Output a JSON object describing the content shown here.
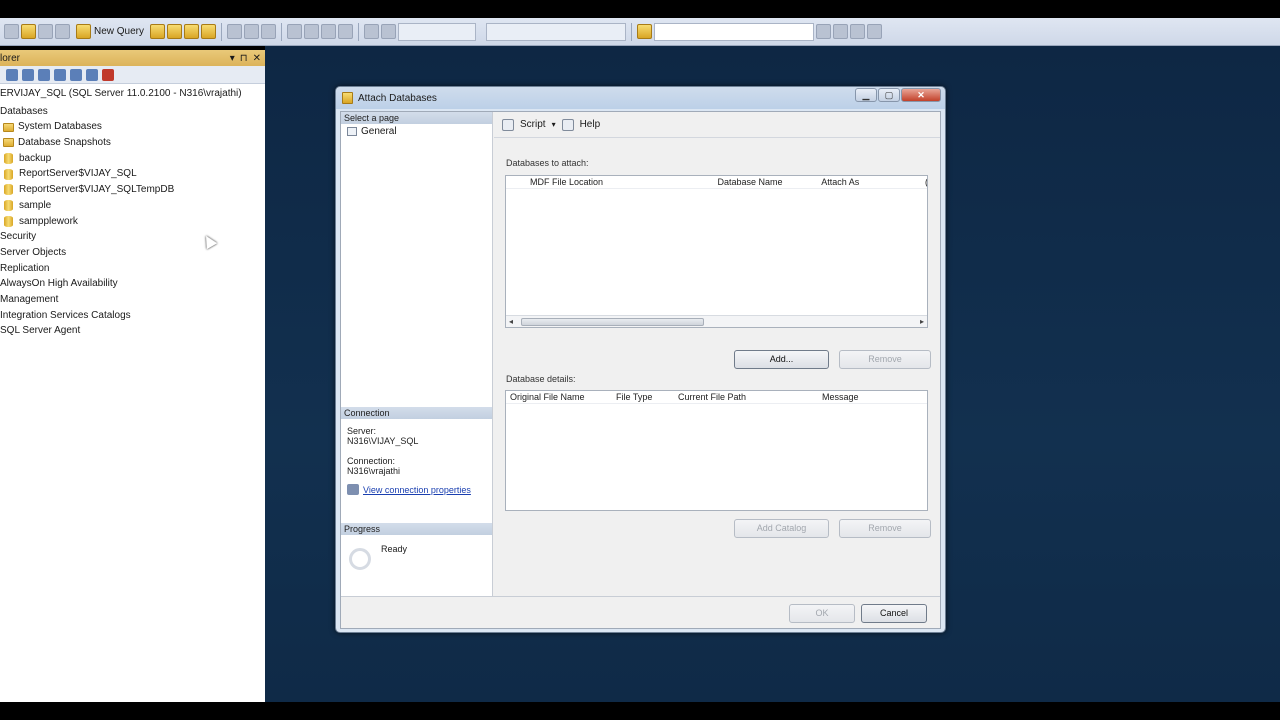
{
  "toolbar": {
    "new_query_label": "New Query"
  },
  "object_explorer": {
    "title": "lorer",
    "server_node": "ERVIJAY_SQL (SQL Server 11.0.2100 - N316\\vrajathi)",
    "items": [
      {
        "label": "Databases",
        "kind": "none",
        "level": "l0"
      },
      {
        "label": "System Databases",
        "kind": "folder",
        "level": "l1"
      },
      {
        "label": "Database Snapshots",
        "kind": "folder",
        "level": "l1"
      },
      {
        "label": "backup",
        "kind": "db",
        "level": "l2"
      },
      {
        "label": "ReportServer$VIJAY_SQL",
        "kind": "db",
        "level": "l2"
      },
      {
        "label": "ReportServer$VIJAY_SQLTempDB",
        "kind": "db",
        "level": "l2"
      },
      {
        "label": "sample",
        "kind": "db",
        "level": "l2"
      },
      {
        "label": "sampplework",
        "kind": "db",
        "level": "l2"
      },
      {
        "label": "Security",
        "kind": "none",
        "level": "l0"
      },
      {
        "label": "Server Objects",
        "kind": "none",
        "level": "l0"
      },
      {
        "label": "Replication",
        "kind": "none",
        "level": "l0"
      },
      {
        "label": "AlwaysOn High Availability",
        "kind": "none",
        "level": "l0"
      },
      {
        "label": "Management",
        "kind": "none",
        "level": "l0"
      },
      {
        "label": "Integration Services Catalogs",
        "kind": "none",
        "level": "l0"
      },
      {
        "label": "SQL Server Agent",
        "kind": "none",
        "level": "l0"
      }
    ]
  },
  "dialog": {
    "title": "Attach Databases",
    "select_page_header": "Select a page",
    "pages": [
      "General"
    ],
    "script_label": "Script",
    "help_label": "Help",
    "attach_label": "Databases to attach:",
    "attach_columns": [
      "MDF File Location",
      "Database Name",
      "Attach As",
      "("
    ],
    "add_button": "Add...",
    "remove_button": "Remove",
    "details_label": "Database details:",
    "details_columns": [
      "Original File Name",
      "File Type",
      "Current File Path",
      "Message"
    ],
    "add_catalog_button": "Add Catalog",
    "remove_button_2": "Remove",
    "connection_header": "Connection",
    "server_label": "Server:",
    "server_value": "N316\\VIJAY_SQL",
    "connection_label": "Connection:",
    "connection_value": "N316\\vrajathi",
    "view_connection_link": "View connection properties",
    "progress_header": "Progress",
    "progress_status": "Ready",
    "ok_button": "OK",
    "cancel_button": "Cancel"
  }
}
